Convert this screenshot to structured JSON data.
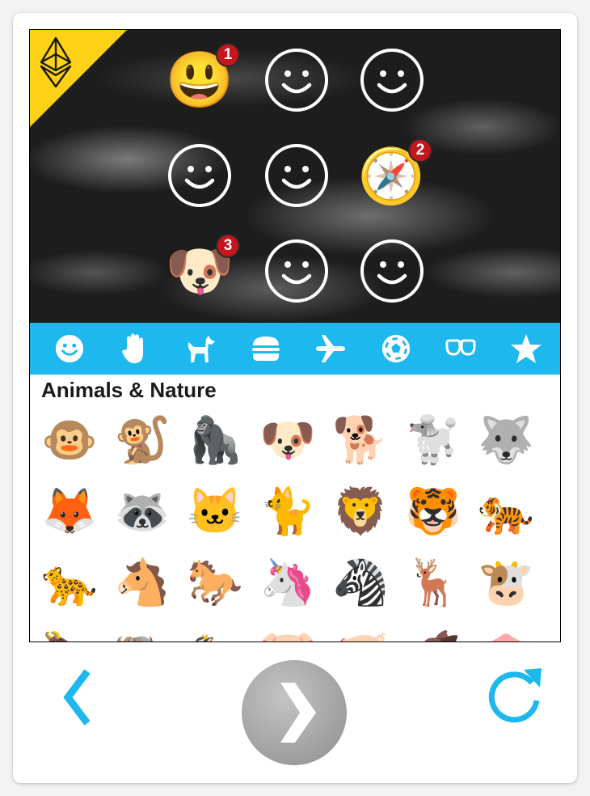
{
  "colors": {
    "accent": "#1cb8ee",
    "badge": "#c4161c",
    "corner": "#fcd116",
    "next_button": "#9e9e9e"
  },
  "lock_grid": {
    "slots": [
      {
        "icon": "grinning-face-emoji",
        "glyph": "😃",
        "badge": "1",
        "filled": true
      },
      {
        "icon": "smiley-outline-icon",
        "filled": false
      },
      {
        "icon": "smiley-outline-icon",
        "filled": false
      },
      {
        "icon": "smiley-outline-icon",
        "filled": false
      },
      {
        "icon": "smiley-outline-icon",
        "filled": false
      },
      {
        "icon": "compass-emoji",
        "glyph": "🧭",
        "badge": "2",
        "filled": true
      },
      {
        "icon": "dog-face-emoji",
        "glyph": "🐶",
        "badge": "3",
        "filled": true
      },
      {
        "icon": "smiley-outline-icon",
        "filled": false
      },
      {
        "icon": "smiley-outline-icon",
        "filled": false
      }
    ]
  },
  "categories": [
    {
      "icon": "smileys-category-icon"
    },
    {
      "icon": "people-hand-category-icon"
    },
    {
      "icon": "animals-category-icon"
    },
    {
      "icon": "food-burger-category-icon"
    },
    {
      "icon": "travel-plane-category-icon"
    },
    {
      "icon": "activity-ball-category-icon"
    },
    {
      "icon": "objects-glasses-category-icon"
    },
    {
      "icon": "symbols-star-category-icon"
    }
  ],
  "section": {
    "title": "Animals & Nature"
  },
  "emoji_grid": {
    "rows": [
      [
        "🐵",
        "🐒",
        "🦍",
        "🐶",
        "🐕",
        "🐩",
        "🐺"
      ],
      [
        "🦊",
        "🦝",
        "🐱",
        "🐈",
        "🦁",
        "🐯",
        "🐅"
      ],
      [
        "🐆",
        "🐴",
        "🐎",
        "🦄",
        "🦓",
        "🦌",
        "🐮"
      ],
      [
        "🐂",
        "🐃",
        "🐄",
        "🐷",
        "🐖",
        "🐗",
        "🐽"
      ]
    ]
  },
  "controls": {
    "back_icon": "chevron-left-icon",
    "next_icon": "chevron-right-icon",
    "reload_icon": "reload-icon"
  }
}
